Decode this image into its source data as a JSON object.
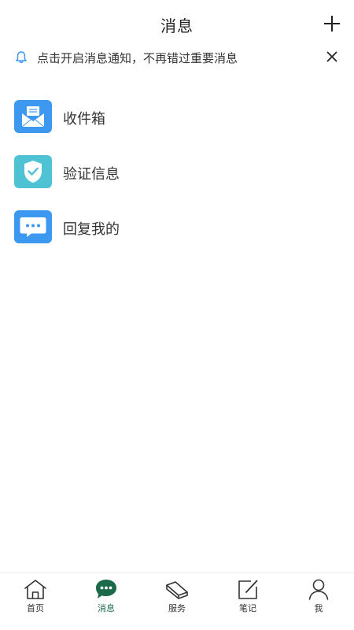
{
  "header": {
    "title": "消息"
  },
  "notice": {
    "text": "点击开启消息通知，不再错过重要消息"
  },
  "messages": [
    {
      "label": "收件箱",
      "icon": "inbox-envelope-icon",
      "color": "#3d98f0"
    },
    {
      "label": "验证信息",
      "icon": "verification-shield-icon",
      "color": "#4fc3d3"
    },
    {
      "label": "回复我的",
      "icon": "reply-chat-icon",
      "color": "#3d98f0"
    }
  ],
  "tabbar": {
    "active_color": "#1b6b4b",
    "tabs": [
      {
        "label": "首页",
        "icon": "home-icon",
        "active": false
      },
      {
        "label": "消息",
        "icon": "message-bubble-icon",
        "active": true
      },
      {
        "label": "服务",
        "icon": "service-icon",
        "active": false
      },
      {
        "label": "笔记",
        "icon": "note-edit-icon",
        "active": false
      },
      {
        "label": "我",
        "icon": "user-icon",
        "active": false
      }
    ]
  }
}
